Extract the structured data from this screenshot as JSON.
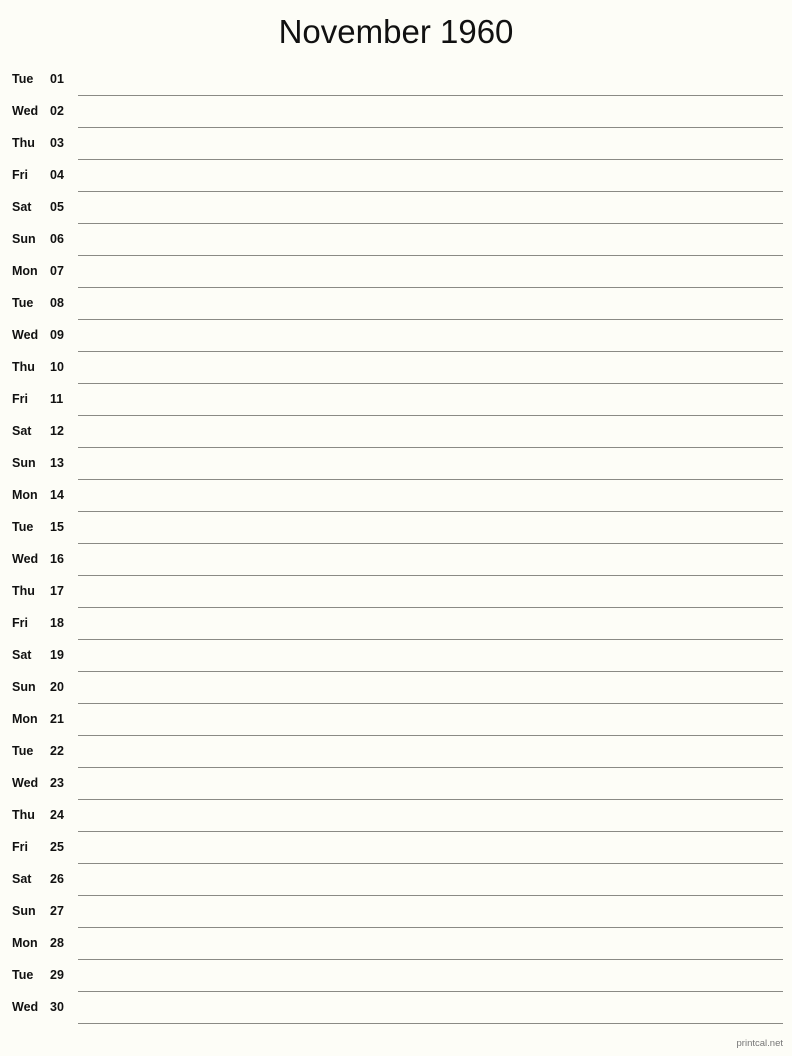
{
  "document": {
    "title": "November 1960",
    "month": "November",
    "year": "1960",
    "footer_text": "printcal.net",
    "colors": {
      "background": "#fdfdf7",
      "text": "#111111",
      "rule": "#8a8a85",
      "footer": "#767676"
    }
  },
  "rows": [
    {
      "weekday": "Tue",
      "day": "01"
    },
    {
      "weekday": "Wed",
      "day": "02"
    },
    {
      "weekday": "Thu",
      "day": "03"
    },
    {
      "weekday": "Fri",
      "day": "04"
    },
    {
      "weekday": "Sat",
      "day": "05"
    },
    {
      "weekday": "Sun",
      "day": "06"
    },
    {
      "weekday": "Mon",
      "day": "07"
    },
    {
      "weekday": "Tue",
      "day": "08"
    },
    {
      "weekday": "Wed",
      "day": "09"
    },
    {
      "weekday": "Thu",
      "day": "10"
    },
    {
      "weekday": "Fri",
      "day": "11"
    },
    {
      "weekday": "Sat",
      "day": "12"
    },
    {
      "weekday": "Sun",
      "day": "13"
    },
    {
      "weekday": "Mon",
      "day": "14"
    },
    {
      "weekday": "Tue",
      "day": "15"
    },
    {
      "weekday": "Wed",
      "day": "16"
    },
    {
      "weekday": "Thu",
      "day": "17"
    },
    {
      "weekday": "Fri",
      "day": "18"
    },
    {
      "weekday": "Sat",
      "day": "19"
    },
    {
      "weekday": "Sun",
      "day": "20"
    },
    {
      "weekday": "Mon",
      "day": "21"
    },
    {
      "weekday": "Tue",
      "day": "22"
    },
    {
      "weekday": "Wed",
      "day": "23"
    },
    {
      "weekday": "Thu",
      "day": "24"
    },
    {
      "weekday": "Fri",
      "day": "25"
    },
    {
      "weekday": "Sat",
      "day": "26"
    },
    {
      "weekday": "Sun",
      "day": "27"
    },
    {
      "weekday": "Mon",
      "day": "28"
    },
    {
      "weekday": "Tue",
      "day": "29"
    },
    {
      "weekday": "Wed",
      "day": "30"
    }
  ]
}
